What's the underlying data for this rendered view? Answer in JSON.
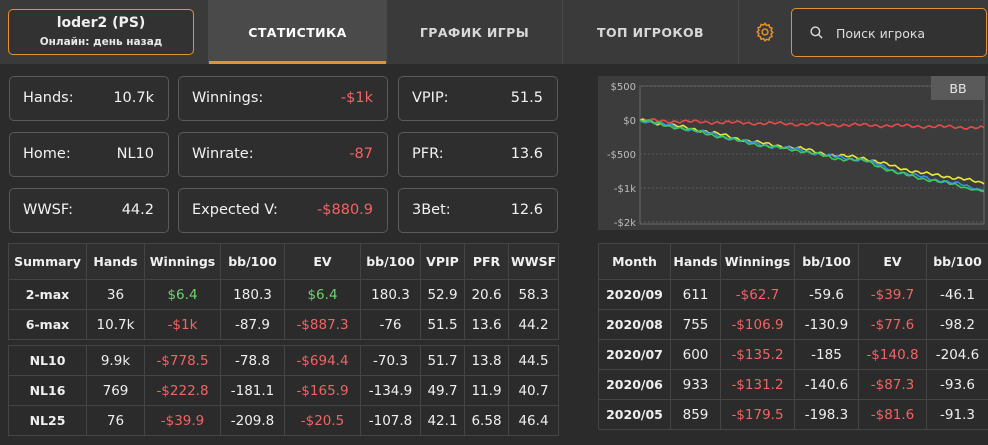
{
  "player": {
    "name": "loder2 (PS)",
    "status": "Онлайн: день назад"
  },
  "nav": {
    "tabs": [
      {
        "label": "СТАТИСТИКА",
        "active": true
      },
      {
        "label": "ГРАФИК ИГРЫ",
        "active": false
      },
      {
        "label": "ТОП ИГРОКОВ",
        "active": false
      }
    ],
    "settings_icon": "gear-icon"
  },
  "search": {
    "placeholder": "Поиск игрока",
    "icon": "search-icon"
  },
  "colors": {
    "accent": "#e8912b",
    "negative": "#f06464",
    "positive": "#6fd46f"
  },
  "stats": {
    "hands": {
      "label": "Hands:",
      "value": "10.7k"
    },
    "winnings": {
      "label": "Winnings:",
      "value": "-$1k"
    },
    "vpip": {
      "label": "VPIP:",
      "value": "51.5"
    },
    "home": {
      "label": "Home:",
      "value": "NL10"
    },
    "winrate": {
      "label": "Winrate:",
      "value": "-87"
    },
    "pfr": {
      "label": "PFR:",
      "value": "13.6"
    },
    "wwsf": {
      "label": "WWSF:",
      "value": "44.2"
    },
    "expected": {
      "label": "Expected V:",
      "value": "-$880.9"
    },
    "threebet": {
      "label": "3Bet:",
      "value": "12.6"
    }
  },
  "chart_data": {
    "type": "line",
    "badge": "BB",
    "y_ticks": [
      "$500",
      "$0",
      "-$500",
      "-$1k",
      "-$2k"
    ],
    "ylim": [
      -1500,
      500
    ],
    "x": [
      0,
      1000,
      2000,
      3000,
      4000,
      5000,
      6000,
      7000,
      8000,
      9000,
      10000,
      10700
    ],
    "series": [
      {
        "color": "#e84a4a",
        "values": [
          0,
          -20,
          -30,
          -40,
          -50,
          -60,
          -70,
          -75,
          -85,
          -95,
          -105,
          -115
        ]
      },
      {
        "color": "#e8e83a",
        "values": [
          0,
          -80,
          -160,
          -270,
          -360,
          -420,
          -520,
          -560,
          -700,
          -800,
          -860,
          -940
        ]
      },
      {
        "color": "#3a8ee8",
        "values": [
          0,
          -90,
          -180,
          -290,
          -380,
          -440,
          -540,
          -590,
          -760,
          -860,
          -950,
          -1060
        ]
      },
      {
        "color": "#3ac85a",
        "values": [
          0,
          -95,
          -190,
          -300,
          -390,
          -450,
          -560,
          -600,
          -780,
          -880,
          -970,
          -1100
        ]
      }
    ]
  },
  "summary": {
    "headers": [
      "Summary",
      "Hands",
      "Winnings",
      "bb/100",
      "EV",
      "bb/100",
      "VPIP",
      "PFR",
      "WWSF"
    ],
    "rows_a": [
      [
        "2-max",
        "36",
        "$6.4",
        "180.3",
        "$6.4",
        "180.3",
        "52.9",
        "20.6",
        "58.3"
      ],
      [
        "6-max",
        "10.7k",
        "-$1k",
        "-87.9",
        "-$887.3",
        "-76",
        "51.5",
        "13.6",
        "44.2"
      ]
    ],
    "rows_b": [
      [
        "NL10",
        "9.9k",
        "-$778.5",
        "-78.8",
        "-$694.4",
        "-70.3",
        "51.7",
        "13.8",
        "44.5"
      ],
      [
        "NL16",
        "769",
        "-$222.8",
        "-181.1",
        "-$165.9",
        "-134.9",
        "49.7",
        "11.9",
        "40.7"
      ],
      [
        "NL25",
        "76",
        "-$39.9",
        "-209.8",
        "-$20.5",
        "-107.8",
        "42.1",
        "6.58",
        "46.4"
      ]
    ]
  },
  "monthly": {
    "headers": [
      "Month",
      "Hands",
      "Winnings",
      "bb/100",
      "EV",
      "bb/100"
    ],
    "rows": [
      [
        "2020/09",
        "611",
        "-$62.7",
        "-59.6",
        "-$39.7",
        "-46.1"
      ],
      [
        "2020/08",
        "755",
        "-$106.9",
        "-130.9",
        "-$77.6",
        "-98.2"
      ],
      [
        "2020/07",
        "600",
        "-$135.2",
        "-185",
        "-$140.8",
        "-204.6"
      ],
      [
        "2020/06",
        "933",
        "-$131.2",
        "-140.6",
        "-$87.3",
        "-93.6"
      ],
      [
        "2020/05",
        "859",
        "-$179.5",
        "-198.3",
        "-$81.6",
        "-91.3"
      ]
    ]
  }
}
